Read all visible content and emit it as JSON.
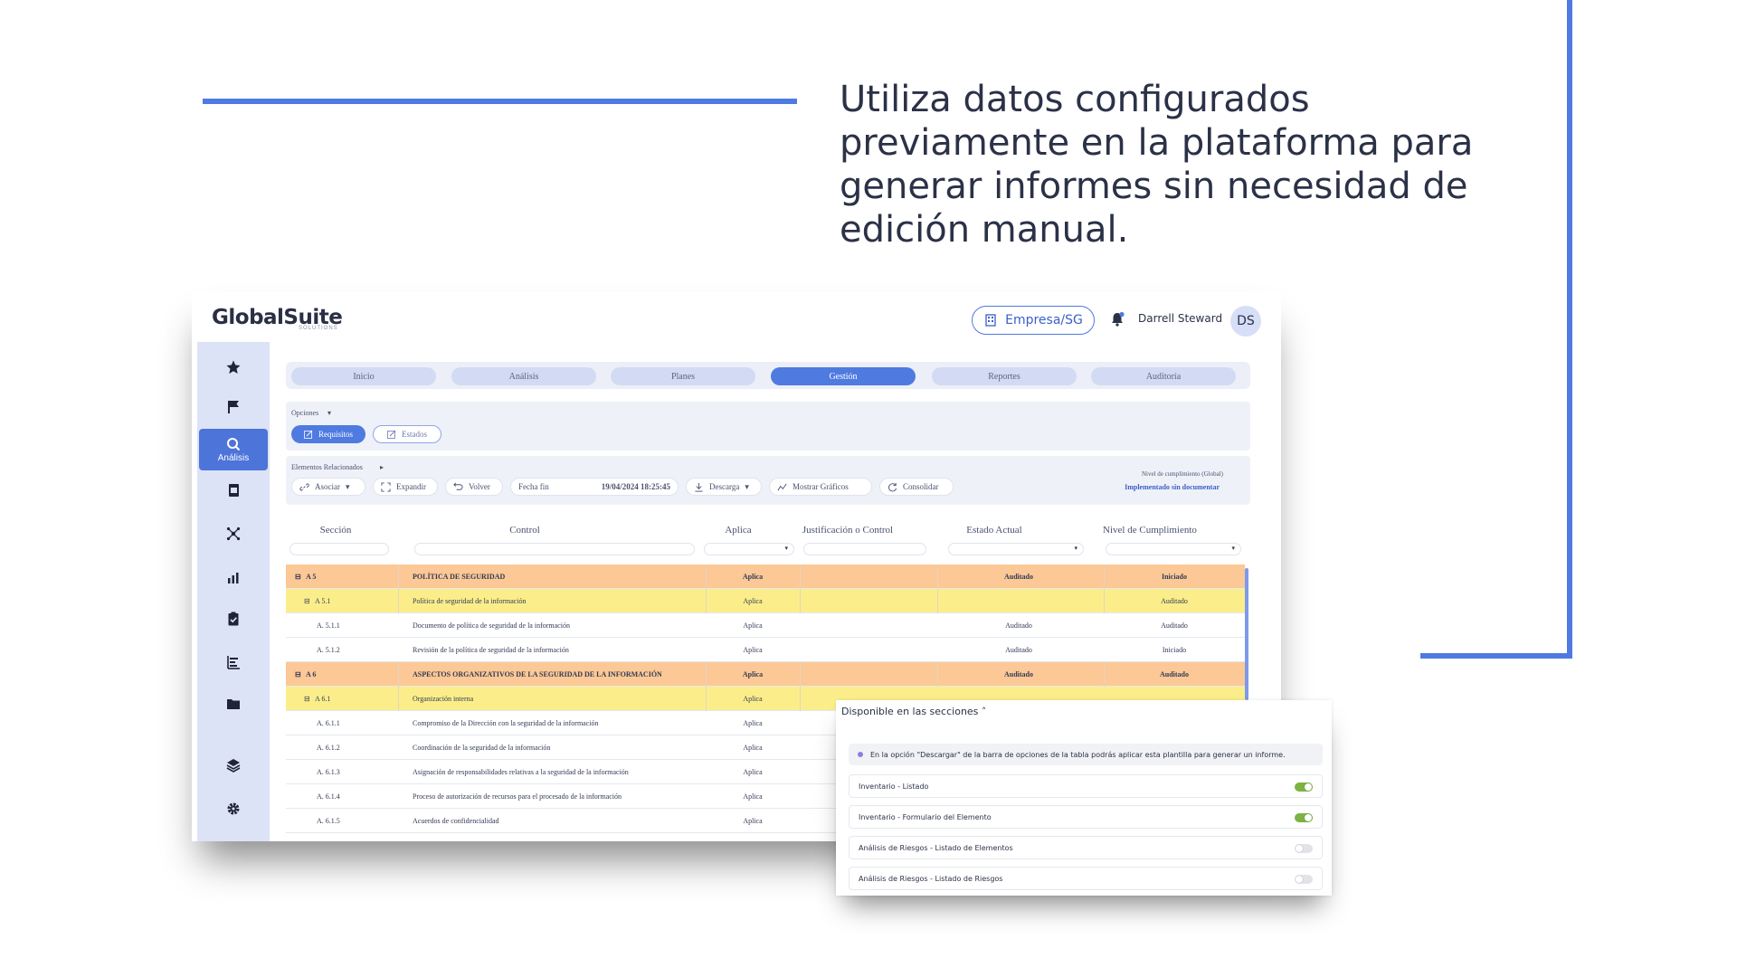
{
  "headline": "Utiliza datos configurados previamente en la plataforma para generar informes sin necesidad de edición manual.",
  "app": {
    "logo": "GlobalSuite",
    "logo_sub": "SOLUTIONS",
    "company_button": "Empresa/SG",
    "user_name": "Darrell Steward",
    "avatar_initials": "DS",
    "sidebar_active_label": "Análisis",
    "tabs": [
      "Inicio",
      "Análisis",
      "Planes",
      "Gestión",
      "Reportes",
      "Auditoría"
    ],
    "active_tab": "Gestión",
    "options_label": "Opciones",
    "options_pills": [
      "Requisitos",
      "Estados"
    ],
    "related_label": "Elementos Relacionados",
    "toolbar": {
      "asociar": "Asociar",
      "expandir": "Expandir",
      "volver": "Volver",
      "fecha_label": "Fecha fin",
      "fecha_value": "19/04/2024 18:25:45",
      "descarga": "Descarga",
      "mostrar_graficos": "Mostrar Gráficos",
      "consolidar": "Consolidar"
    },
    "compliance_label": "Nivel de cumplimiento (Global)",
    "compliance_value": "Implementado sin documentar",
    "table": {
      "headers": [
        "Sección",
        "Control",
        "Aplica",
        "Justificación o Control",
        "Estado Actual",
        "Nivel de Cumplimiento"
      ],
      "rows": [
        {
          "type": "sec",
          "seccion": "A 5",
          "control": "POLÍTICA DE SEGURIDAD",
          "aplica": "Aplica",
          "just": "",
          "estado": "Auditado",
          "nivel": "Iniciado"
        },
        {
          "type": "sub",
          "seccion": "A 5.1",
          "control": "Política de seguridad de la información",
          "aplica": "Aplica",
          "just": "",
          "estado": "",
          "nivel": "Auditado"
        },
        {
          "type": "item",
          "seccion": "A. 5.1.1",
          "control": "Documento de política de seguridad de la información",
          "aplica": "Aplica",
          "just": "",
          "estado": "Auditado",
          "nivel": "Auditado"
        },
        {
          "type": "item",
          "seccion": "A. 5.1.2",
          "control": "Revisión de la política de seguridad de la información",
          "aplica": "Aplica",
          "just": "",
          "estado": "Auditado",
          "nivel": "Iniciado"
        },
        {
          "type": "sec",
          "seccion": "A 6",
          "control": "ASPECTOS ORGANIZATIVOS DE LA SEGURIDAD DE LA INFORMACIÓN",
          "aplica": "Aplica",
          "just": "",
          "estado": "Auditado",
          "nivel": "Auditado"
        },
        {
          "type": "sub",
          "seccion": "A 6.1",
          "control": "Organización interna",
          "aplica": "Aplica",
          "just": "",
          "estado": "",
          "nivel": ""
        },
        {
          "type": "item",
          "seccion": "A. 6.1.1",
          "control": "Compromiso de la Dirección con la seguridad de la información",
          "aplica": "Aplica",
          "just": "",
          "estado": "",
          "nivel": ""
        },
        {
          "type": "item",
          "seccion": "A. 6.1.2",
          "control": "Coordinación de la seguridad de la información",
          "aplica": "Aplica",
          "just": "",
          "estado": "",
          "nivel": ""
        },
        {
          "type": "item",
          "seccion": "A. 6.1.3",
          "control": "Asignación de responsabilidades relativas a la seguridad de la información",
          "aplica": "Aplica",
          "just": "",
          "estado": "",
          "nivel": ""
        },
        {
          "type": "item",
          "seccion": "A. 6.1.4",
          "control": "Proceso de autorización de recursos para el procesado de la información",
          "aplica": "Aplica",
          "just": "",
          "estado": "",
          "nivel": ""
        },
        {
          "type": "item",
          "seccion": "A. 6.1.5",
          "control": "Acuerdos de confidencialidad",
          "aplica": "Aplica",
          "just": "",
          "estado": "",
          "nivel": ""
        }
      ]
    }
  },
  "popup": {
    "title": "Disponible en las secciones",
    "note": "En la opción \"Descargar\" de la barra de opciones de la tabla podrás aplicar esta plantilla para generar un informe.",
    "items": [
      {
        "label": "Inventario - Listado",
        "enabled": true
      },
      {
        "label": "Inventario - Formulario del Elemento",
        "enabled": true
      },
      {
        "label": "Análisis de Riesgos - Listado de Elementos",
        "enabled": false
      },
      {
        "label": "Análisis de Riesgos - Listado de Riesgos",
        "enabled": false
      }
    ]
  },
  "colors": {
    "accent": "#4f7ae0",
    "section_row": "#fbc896",
    "subsection_row": "#fbee8a",
    "sidebar_bg": "#dde3f6",
    "toggle_on": "#7cb342"
  }
}
